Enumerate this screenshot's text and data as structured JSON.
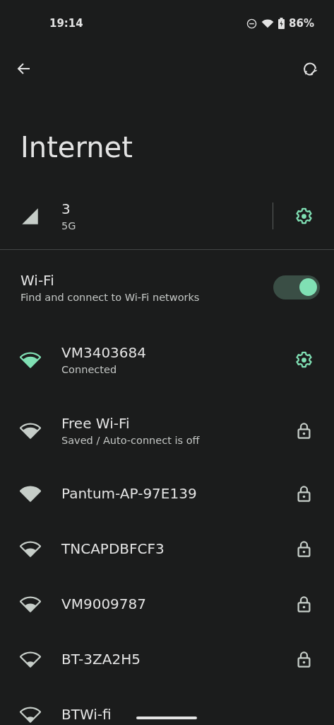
{
  "status_bar": {
    "time": "19:14",
    "battery": "86%"
  },
  "toolbar": {
    "title": "Internet"
  },
  "mobile": {
    "name": "3",
    "type": "5G"
  },
  "wifi": {
    "title": "Wi-Fi",
    "subtitle": "Find and connect to Wi-Fi networks",
    "on": true
  },
  "networks": [
    {
      "name": "VM3403684",
      "status": "Connected",
      "connected": true,
      "secured": false,
      "kind": "strong"
    },
    {
      "name": "Free Wi-Fi",
      "status": "Saved / Auto-connect is off",
      "connected": false,
      "secured": true,
      "kind": "strong"
    },
    {
      "name": "Pantum-AP-97E139",
      "connected": false,
      "secured": true,
      "kind": "full"
    },
    {
      "name": "TNCAPDBFCF3",
      "connected": false,
      "secured": true,
      "kind": "medium"
    },
    {
      "name": "VM9009787",
      "connected": false,
      "secured": true,
      "kind": "medium"
    },
    {
      "name": "BT-3ZA2H5",
      "connected": false,
      "secured": true,
      "kind": "weak"
    },
    {
      "name": "BTWi-fi",
      "connected": false,
      "secured": false,
      "kind": "weak"
    }
  ]
}
